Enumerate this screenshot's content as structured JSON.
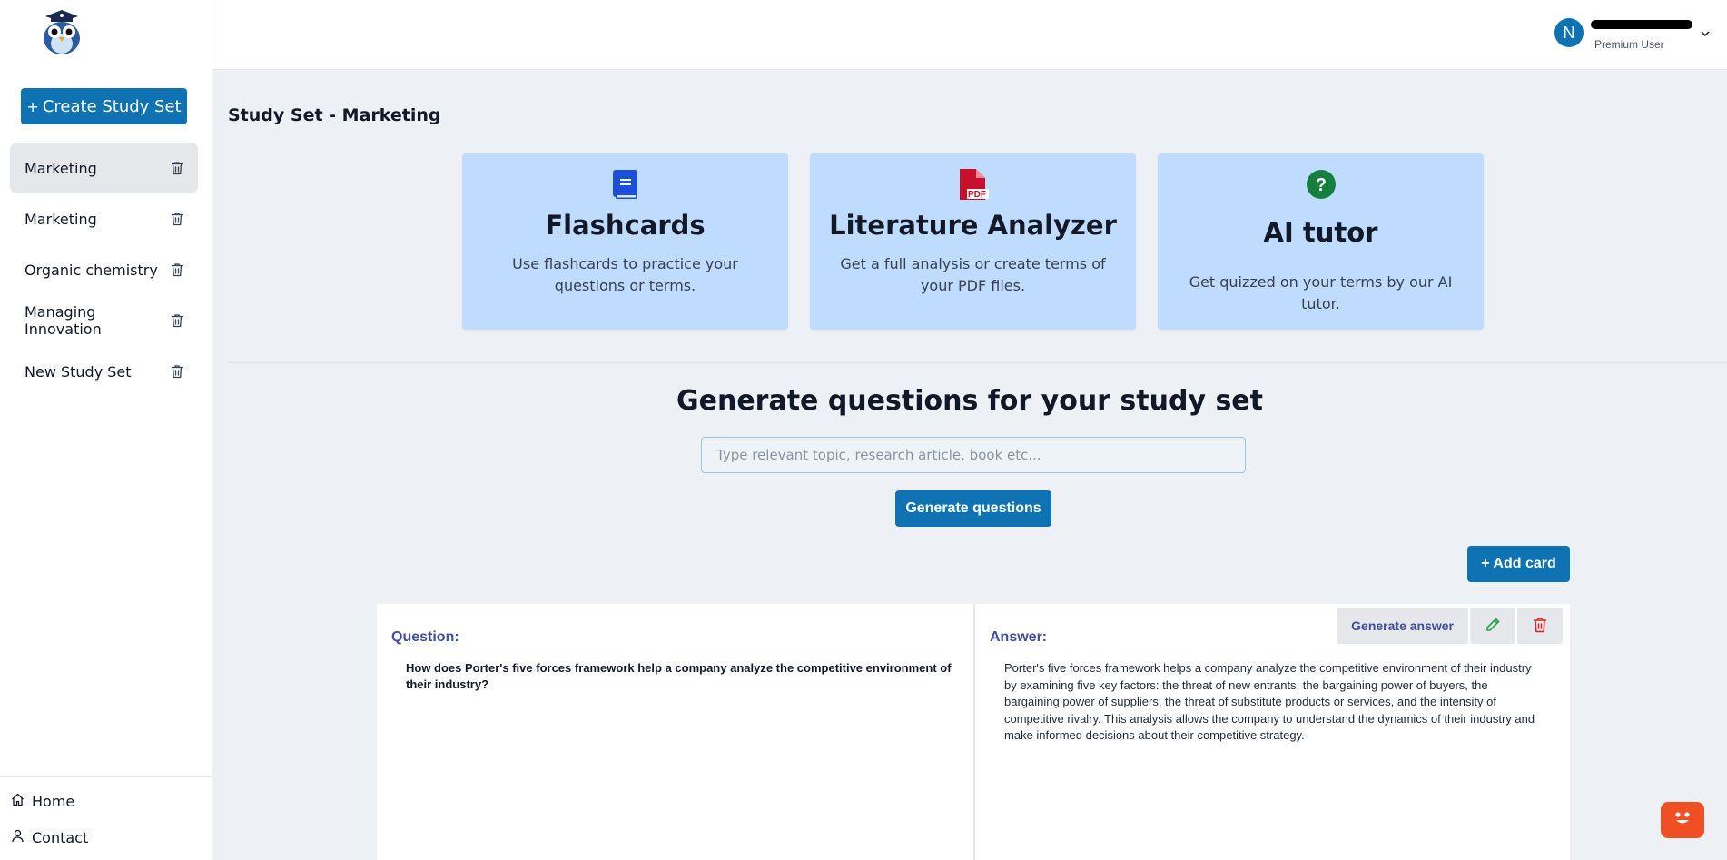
{
  "sidebar": {
    "create_label": "Create Study Set",
    "sets": [
      {
        "label": "Marketing"
      },
      {
        "label": "Marketing"
      },
      {
        "label": "Organic chemistry"
      },
      {
        "label": "Managing Innovation"
      },
      {
        "label": "New Study Set"
      }
    ],
    "links": {
      "home": "Home",
      "contact": "Contact"
    }
  },
  "header": {
    "avatar_initial": "N",
    "user_role": "Premium User"
  },
  "main": {
    "page_title": "Study Set - Marketing",
    "features": [
      {
        "title": "Flashcards",
        "desc": "Use flashcards to practice your questions or terms.",
        "icon": "book-icon"
      },
      {
        "title": "Literature Analyzer",
        "desc": "Get a full analysis or create terms of your PDF files.",
        "icon": "pdf-icon",
        "icon_text": "PDF"
      },
      {
        "title": "AI tutor",
        "desc": "Get quizzed on your terms by our AI tutor.",
        "icon": "question-icon",
        "icon_text": "?"
      }
    ],
    "generate": {
      "title": "Generate questions for your study set",
      "placeholder": "Type relevant topic, research article, book etc...",
      "button": "Generate questions"
    },
    "add_card_label": "+ Add card",
    "card": {
      "question_label": "Question:",
      "question": "How does Porter's five forces framework help a company analyze the competitive environment of their industry?",
      "answer_label": "Answer:",
      "answer": "Porter's five forces framework helps a company analyze the competitive environment of their industry by examining five key factors: the threat of new entrants, the bargaining power of buyers, the bargaining power of suppliers, the threat of substitute products or services, and the intensity of competitive rivalry. This analysis allows the company to understand the dynamics of their industry and make informed decisions about their competitive strategy.",
      "generate_answer_label": "Generate answer"
    }
  },
  "colors": {
    "primary": "#0f72b2",
    "feature_bg": "#bfdbfe",
    "label_accent": "#3f4ea0",
    "chat": "#f04e23"
  }
}
